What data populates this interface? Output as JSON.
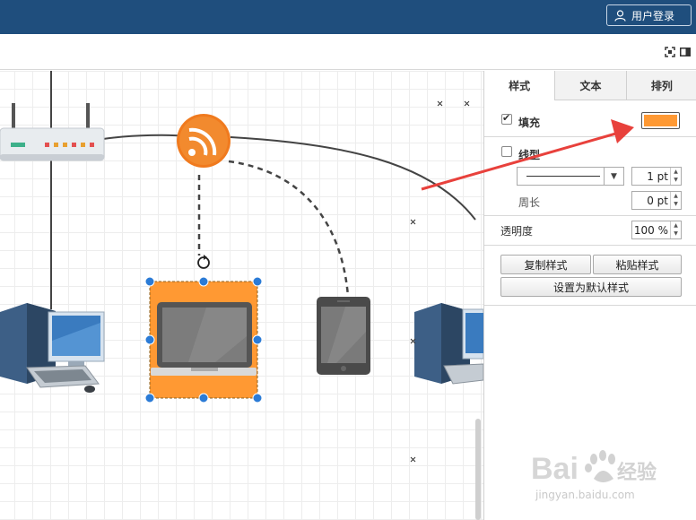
{
  "header": {
    "login_label": "用户登录",
    "login_icon": "user-icon",
    "bg_color": "#1f4e7d"
  },
  "toolbar": {
    "icons": [
      "fullscreen-icon",
      "panel-toggle-icon"
    ]
  },
  "canvas": {
    "nodes": [
      "router",
      "rss-feed",
      "desktop-computer-left",
      "laptop",
      "tablet",
      "desktop-computer-right"
    ],
    "selected_node": "laptop",
    "selected_fill": "#ff9933"
  },
  "panel": {
    "tabs": [
      {
        "label": "样式",
        "active": true
      },
      {
        "label": "文本",
        "active": false
      },
      {
        "label": "排列",
        "active": false
      }
    ],
    "fill": {
      "label": "填充",
      "checked": true,
      "color": "#ff9933"
    },
    "line": {
      "label": "线型",
      "checked": false,
      "width": "1 pt",
      "perimeter_label": "周长",
      "perimeter": "0 pt"
    },
    "opacity": {
      "label": "透明度",
      "value": "100 %"
    },
    "buttons": {
      "copy_style": "复制样式",
      "paste_style": "粘贴样式",
      "set_default": "设置为默认样式"
    }
  },
  "annotation": {
    "arrow_color": "#e8413c"
  },
  "watermark": {
    "brand": "Baidu经验",
    "url": "jingyan.baidu.com"
  }
}
